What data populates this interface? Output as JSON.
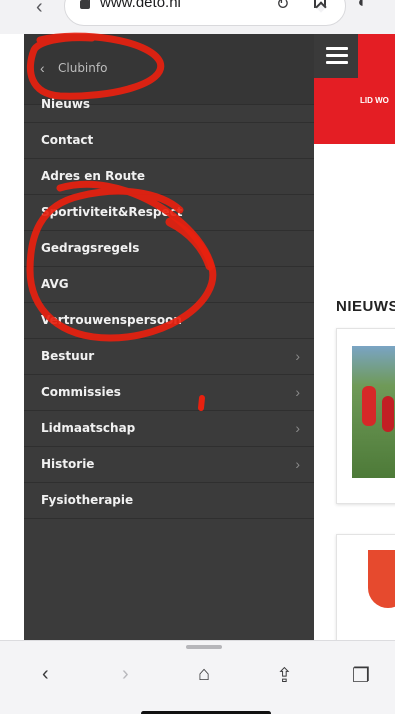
{
  "browser": {
    "url": "www.deto.nl",
    "back_icon": "chevron-left-icon",
    "reload_icon": "reload-icon",
    "bookmark_icon": "bookmark-icon",
    "reader_icon": "reader-icon"
  },
  "site": {
    "banner_text": "LID WO",
    "news_title": "NIEUWS",
    "accent_color": "#e41e24",
    "menu_color": "#3b3b3b"
  },
  "drawer": {
    "back_label": "Clubinfo",
    "items": [
      {
        "label": "Nieuws",
        "has_arrow": false
      },
      {
        "label": "Contact",
        "has_arrow": false
      },
      {
        "label": "Adres en Route",
        "has_arrow": false
      },
      {
        "label": "Sportiviteit&Respect",
        "has_arrow": false
      },
      {
        "label": "Gedragsregels",
        "has_arrow": false
      },
      {
        "label": "AVG",
        "has_arrow": false
      },
      {
        "label": "Vertrouwenspersoon",
        "has_arrow": false
      },
      {
        "label": "Bestuur",
        "has_arrow": true
      },
      {
        "label": "Commissies",
        "has_arrow": true
      },
      {
        "label": "Lidmaatschap",
        "has_arrow": true
      },
      {
        "label": "Historie",
        "has_arrow": true
      },
      {
        "label": "Fysiotherapie",
        "has_arrow": false
      }
    ]
  },
  "toolbar": {
    "back_glyph": "‹",
    "forward_glyph": "›",
    "home_glyph": "⌂",
    "share_glyph": "⇪",
    "tabs_glyph": "❐"
  }
}
